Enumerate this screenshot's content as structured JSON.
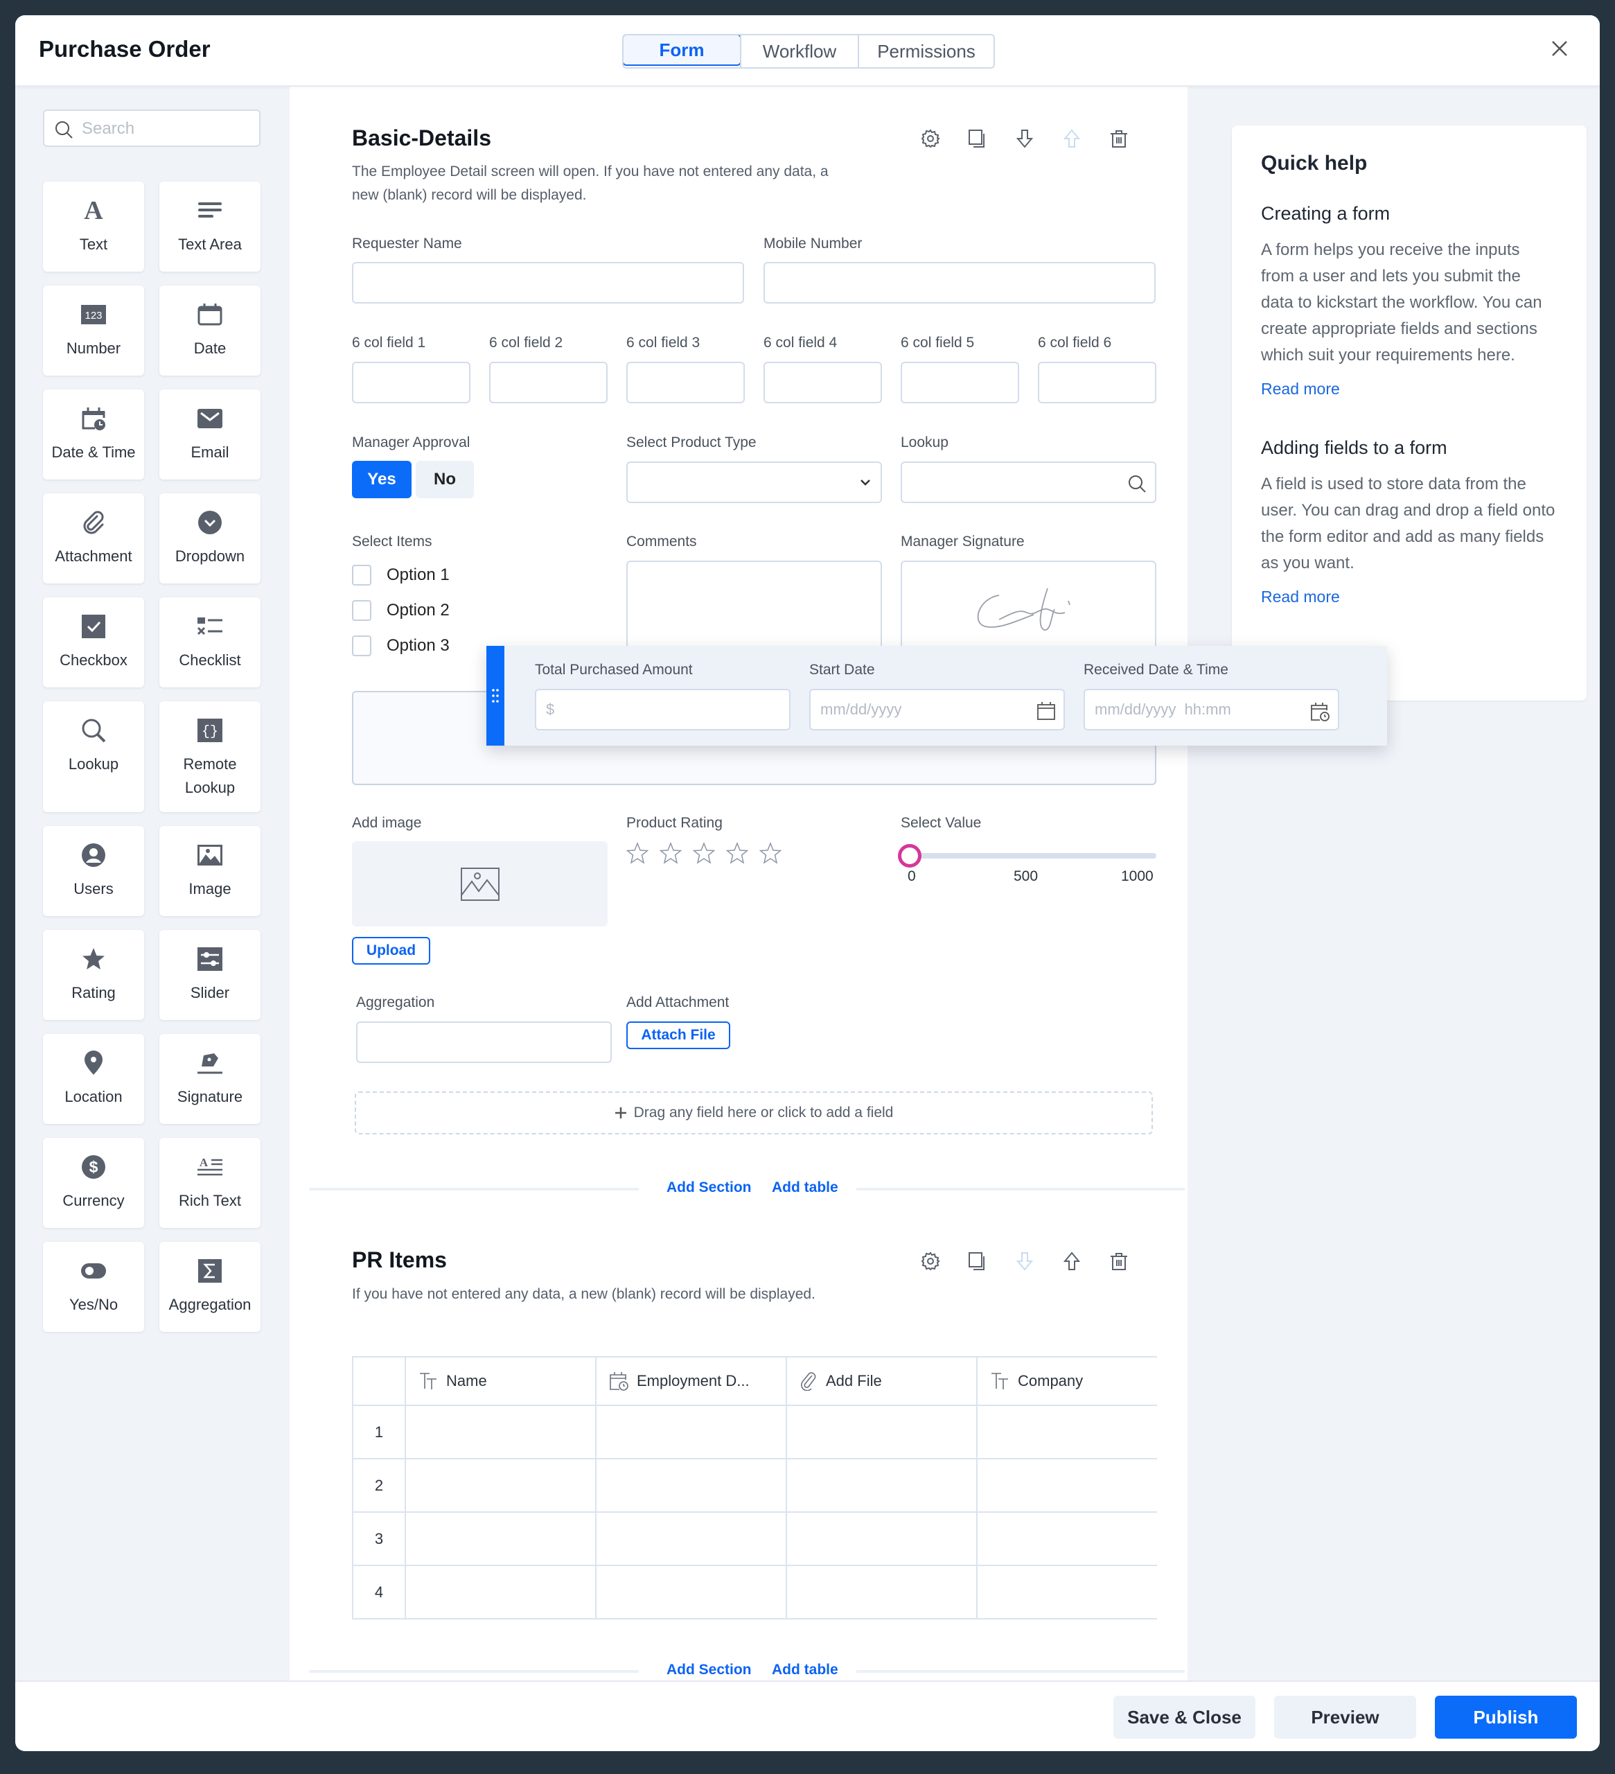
{
  "header": {
    "title": "Purchase Order",
    "tabs": [
      {
        "label": "Form",
        "active": true
      },
      {
        "label": "Workflow",
        "active": false
      },
      {
        "label": "Permissions",
        "active": false
      }
    ]
  },
  "palette": {
    "search_placeholder": "Search",
    "items": [
      {
        "label": "Text",
        "icon": "text-icon"
      },
      {
        "label": "Text Area",
        "icon": "text-area-icon"
      },
      {
        "label": "Number",
        "icon": "number-icon"
      },
      {
        "label": "Date",
        "icon": "date-icon"
      },
      {
        "label": "Date & Time",
        "icon": "date-time-icon"
      },
      {
        "label": "Email",
        "icon": "email-icon"
      },
      {
        "label": "Attachment",
        "icon": "attachment-icon"
      },
      {
        "label": "Dropdown",
        "icon": "dropdown-icon"
      },
      {
        "label": "Checkbox",
        "icon": "checkbox-icon"
      },
      {
        "label": "Checklist",
        "icon": "checklist-icon"
      },
      {
        "label": "Lookup",
        "icon": "lookup-icon"
      },
      {
        "label": "Remote Lookup",
        "icon": "remote-lookup-icon"
      },
      {
        "label": "Users",
        "icon": "users-icon"
      },
      {
        "label": "Image",
        "icon": "image-icon"
      },
      {
        "label": "Rating",
        "icon": "rating-icon"
      },
      {
        "label": "Slider",
        "icon": "slider-icon"
      },
      {
        "label": "Location",
        "icon": "location-icon"
      },
      {
        "label": "Signature",
        "icon": "signature-icon"
      },
      {
        "label": "Currency",
        "icon": "currency-icon"
      },
      {
        "label": "Rich Text",
        "icon": "rich-text-icon"
      },
      {
        "label": "Yes/No",
        "icon": "yes-no-icon"
      },
      {
        "label": "Aggregation",
        "icon": "aggregation-icon"
      }
    ]
  },
  "section1": {
    "title": "Basic-Details",
    "description": "The Employee Detail screen will open. If you have not entered any data, a new (blank) record will be displayed.",
    "fields": {
      "requester_name": {
        "label": "Requester Name",
        "value": ""
      },
      "mobile_number": {
        "label": "Mobile Number",
        "value": ""
      },
      "six_col": [
        {
          "label": "6 col field 1",
          "value": ""
        },
        {
          "label": "6 col field 2",
          "value": ""
        },
        {
          "label": "6 col field 3",
          "value": ""
        },
        {
          "label": "6 col field 4",
          "value": ""
        },
        {
          "label": "6 col field 5",
          "value": ""
        },
        {
          "label": "6 col field 6",
          "value": ""
        }
      ],
      "manager_approval": {
        "label": "Manager Approval",
        "yes": "Yes",
        "no": "No",
        "selected": "Yes"
      },
      "product_type": {
        "label": "Select Product Type",
        "value": ""
      },
      "lookup": {
        "label": "Lookup",
        "value": ""
      },
      "select_items": {
        "label": "Select Items",
        "options": [
          {
            "label": "Option 1",
            "checked": false
          },
          {
            "label": "Option 2",
            "checked": false
          },
          {
            "label": "Option 3",
            "checked": false
          }
        ]
      },
      "comments": {
        "label": "Comments",
        "value": ""
      },
      "manager_signature": {
        "label": "Manager Signature"
      },
      "add_image": {
        "label": "Add image",
        "upload": "Upload"
      },
      "product_rating": {
        "label": "Product Rating",
        "value": 0,
        "max": 5
      },
      "select_value": {
        "label": "Select Value",
        "value": 0,
        "min": 0,
        "max": 1000,
        "ticks": [
          "0",
          "500",
          "1000"
        ]
      },
      "aggregation": {
        "label": "Aggregation",
        "value": ""
      },
      "add_attachment": {
        "label": "Add Attachment",
        "button": "Attach File"
      }
    },
    "add_field_hint": "Drag any field here or click to add a field"
  },
  "dragging_row": {
    "total_purchased_amount": {
      "label": "Total Purchased Amount",
      "placeholder": "$"
    },
    "start_date": {
      "label": "Start Date",
      "placeholder": "mm/dd/yyyy"
    },
    "received_date_time": {
      "label": "Received Date & Time",
      "placeholder": "mm/dd/yyyy  hh:mm"
    }
  },
  "section_links": {
    "add_section": "Add Section",
    "add_table": "Add table"
  },
  "section2": {
    "title": "PR Items",
    "description": "If you have not entered any data, a new (blank) record will be displayed.",
    "table": {
      "columns": [
        {
          "label": "Name",
          "icon": "text-type-icon"
        },
        {
          "label": "Employment D...",
          "icon": "date-time-icon"
        },
        {
          "label": "Add File",
          "icon": "attachment-icon"
        },
        {
          "label": "Company",
          "icon": "text-type-icon"
        }
      ],
      "rows": [
        "1",
        "2",
        "3",
        "4"
      ]
    }
  },
  "help": {
    "title": "Quick help",
    "sections": [
      {
        "heading": "Creating a form",
        "body": "A form helps you receive the inputs from a user and lets you submit the data to kickstart the workflow. You can create appropriate fields and sections which suit your requirements here.",
        "link": "Read more"
      },
      {
        "heading": "Adding fields to a form",
        "body": "A field is used to store data from the user. You can drag and drop a field onto the form editor and add as many fields as you want.",
        "link": "Read more"
      }
    ]
  },
  "footer": {
    "save_close": "Save & Close",
    "preview": "Preview",
    "publish": "Publish"
  },
  "colors": {
    "accent": "#0b6cfa",
    "slider_thumb": "#d6369a",
    "backdrop": "#263440"
  }
}
